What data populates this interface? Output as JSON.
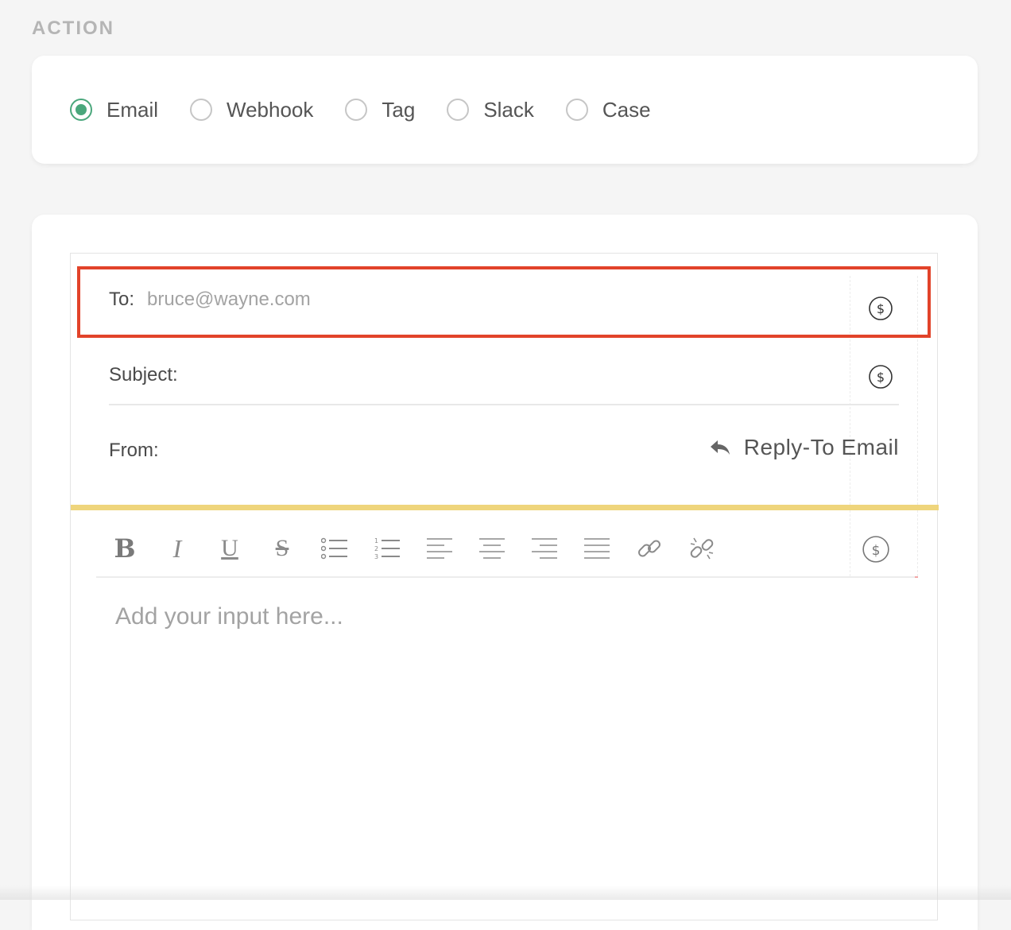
{
  "section": {
    "title": "ACTION"
  },
  "action_types": [
    {
      "label": "Email",
      "checked": true
    },
    {
      "label": "Webhook",
      "checked": false
    },
    {
      "label": "Tag",
      "checked": false
    },
    {
      "label": "Slack",
      "checked": false
    },
    {
      "label": "Case",
      "checked": false
    }
  ],
  "email": {
    "to_label": "To:",
    "to_placeholder": "bruce@wayne.com",
    "subject_label": "Subject:",
    "from_label": "From:",
    "reply_to_label": "Reply-To Email",
    "editor_placeholder": "Add your input here..."
  },
  "icons": {
    "variable": "dollar-circle-icon",
    "reply": "reply-icon"
  },
  "colors": {
    "accent_green": "#4aa77c",
    "highlight_red": "#e2432a",
    "divider_yellow": "#efd57c"
  }
}
